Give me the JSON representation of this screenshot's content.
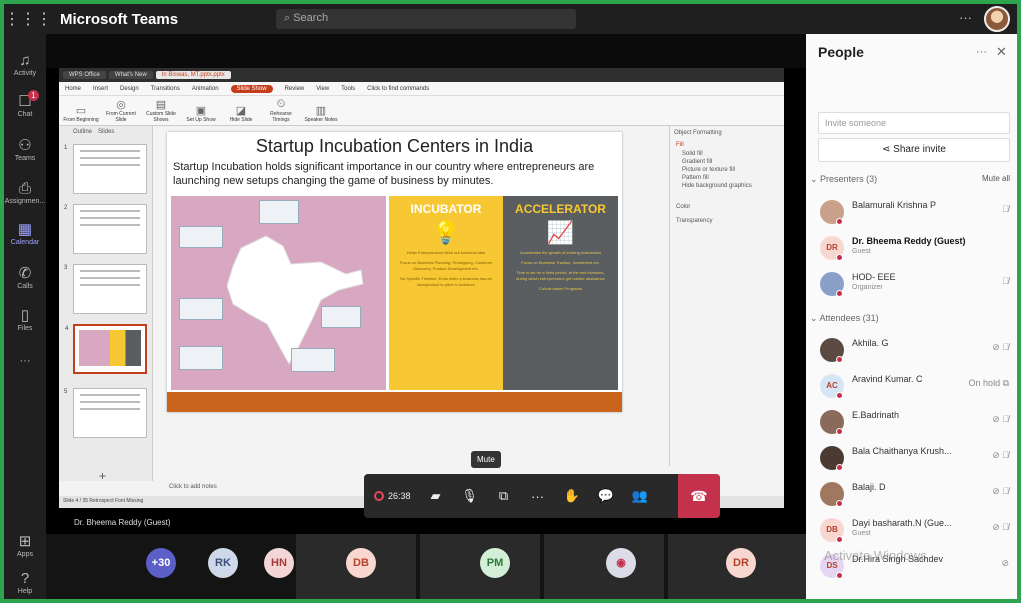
{
  "app": {
    "title": "Microsoft Teams",
    "search_placeholder": "Search",
    "more": "···"
  },
  "rail": [
    {
      "label": "Activity",
      "icon": "bell-icon"
    },
    {
      "label": "Chat",
      "icon": "chat-icon",
      "badge": "1"
    },
    {
      "label": "Teams",
      "icon": "teams-icon"
    },
    {
      "label": "Assignmen...",
      "icon": "assignments-icon"
    },
    {
      "label": "Calendar",
      "icon": "calendar-icon"
    },
    {
      "label": "Calls",
      "icon": "calls-icon"
    },
    {
      "label": "Files",
      "icon": "files-icon"
    },
    {
      "label": "···",
      "icon": "more-icon"
    },
    {
      "label": "Apps",
      "icon": "apps-icon"
    },
    {
      "label": "Help",
      "icon": "help-icon"
    }
  ],
  "ppt": {
    "tabs": [
      "WPS Office",
      "What's New",
      "In Biswas, MT.pptx.pptx"
    ],
    "menu": [
      "Home",
      "Insert",
      "Design",
      "Transitions",
      "Animation",
      "Slide Show",
      "Review",
      "View",
      "Tools"
    ],
    "menu_selected": "Slide Show",
    "command_search": "Click to find commands",
    "ribbon": [
      "From Beginning",
      "From Current Slide",
      "Custom Slide Shows",
      "Set Up Show",
      "Hide Slide",
      "Rehearse Timings",
      "Speaker Notes"
    ],
    "thumb_tabs": [
      "Outline",
      "Slides"
    ],
    "thumb_numbers": [
      "1",
      "2",
      "3",
      "4",
      "5"
    ],
    "notes_placeholder": "Click to add notes",
    "status": "Slide 4 / 35   Retrospect   Font Missing",
    "format_pane": {
      "title": "Object Formatting",
      "section": "Fill",
      "options": [
        "Solid fill",
        "Gradient fill",
        "Picture or texture fill",
        "Pattern fill",
        "Hide background graphics"
      ],
      "color_label": "Color",
      "transparency_label": "Transparency"
    }
  },
  "slide": {
    "title": "Startup Incubation Centers in India",
    "body": "Startup Incubation holds significant importance in our country where entrepreneurs are launching new setups changing the game of business by minutes.",
    "incubator": {
      "heading": "INCUBATOR",
      "texts": [
        "Helps Entrepreneurs flesh out business idea",
        "Focus on Business Planning, Prototyping, Customer Discovery, Product Development etc.",
        "No Specific Timeline. Ends when a business has an idea/product to pitch to investors"
      ]
    },
    "accelerator": {
      "heading": "ACCELERATOR",
      "texts": [
        "Accelerates the growth of existing businesses",
        "Focus on Business Traction, Investment etc.",
        "Time is set for a fixed period, at the end investors, during which entrepreneurs get mentor assistance",
        "Cohort-based Programs"
      ]
    }
  },
  "presenter_label": "Dr. Bheema Reddy (Guest)",
  "call": {
    "tooltip": "Mute",
    "timer": "26:38"
  },
  "strip": [
    {
      "initials": "+30",
      "color": "#5b5fc7",
      "text_color": "#ffffff"
    },
    {
      "initials": "RK",
      "color": "#cfd8e8",
      "text_color": "#3b4f7a"
    },
    {
      "initials": "HN",
      "color": "#f4d6d6",
      "text_color": "#a33b3b"
    },
    {
      "initials": "DB",
      "color": "#f8d7d0",
      "text_color": "#b5432a"
    },
    {
      "initials": "PM",
      "color": "#d4efd8",
      "text_color": "#2c7a3b"
    },
    {
      "initials": "",
      "color": "#dcdce8",
      "text_color": "#c4314b"
    },
    {
      "initials": "DR",
      "color": "#f8d7d0",
      "text_color": "#b5432a"
    }
  ],
  "people": {
    "title": "People",
    "more": "···",
    "close": "✕",
    "invite_placeholder": "Invite someone",
    "share_invite": "Share invite",
    "presenters_label": "Presenters (3)",
    "mute_all": "Mute all",
    "attendees_label": "Attendees (31)",
    "presenters": [
      {
        "name": "Balamurali Krishna P",
        "sub": "",
        "initials": "",
        "color": "#c9a08a",
        "status": "mic-off",
        "bold": false
      },
      {
        "name": "Dr. Bheema Reddy (Guest)",
        "sub": "Guest",
        "initials": "DR",
        "color": "#f8d7d0",
        "status": "",
        "bold": true
      },
      {
        "name": "HOD- EEE",
        "sub": "Organizer",
        "initials": "",
        "color": "#8aa0c8",
        "status": "mic-off",
        "bold": false
      }
    ],
    "attendees": [
      {
        "name": "Akhila. G",
        "sub": "",
        "initials": "",
        "color": "#5a4a42",
        "status": "cam-off mic-off"
      },
      {
        "name": "Aravind Kumar. C",
        "sub": "",
        "initials": "AC",
        "color": "#d6e6f4",
        "status": "On hold"
      },
      {
        "name": "E.Badrinath",
        "sub": "",
        "initials": "",
        "color": "#8a6a5a",
        "status": "cam-off mic-off"
      },
      {
        "name": "Bala Chaithanya Krush...",
        "sub": "",
        "initials": "",
        "color": "#4a3a32",
        "status": "cam-off mic-off"
      },
      {
        "name": "Balaji. D",
        "sub": "",
        "initials": "",
        "color": "#a07860",
        "status": "cam-off mic-off"
      },
      {
        "name": "Dayi basharath.N (Gue...",
        "sub": "Guest",
        "initials": "DB",
        "color": "#f8d7d0",
        "status": "cam-off mic-off"
      },
      {
        "name": "Dr.Hira Singh Sachdev",
        "sub": "",
        "initials": "DS",
        "color": "#e6d6f4",
        "status": "cam-off"
      }
    ]
  },
  "watermark": "Activate Windows"
}
